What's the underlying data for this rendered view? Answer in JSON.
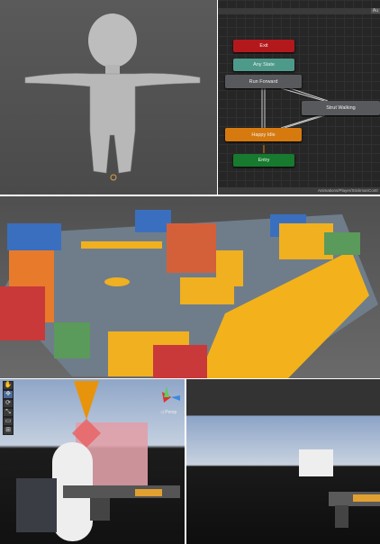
{
  "animator": {
    "header_button": "Au",
    "states": {
      "exit": "Exit",
      "any_state": "Any State",
      "run_forward": "Run Forward",
      "strut_walking": "Strut Walking",
      "happy_idle": "Happy Idle",
      "entry": "Entry"
    },
    "path": "Animations/Player/StickmanContr",
    "colors": {
      "exit": "#b3191c",
      "any_state": "#4e9a8a",
      "default": "#58595c",
      "happy_idle": "#d67a0f",
      "entry": "#177a2f"
    }
  },
  "scene_view": {
    "tools": [
      "✋",
      "✥",
      "⟳",
      "⤡",
      "▭",
      "⊞"
    ],
    "projection_label": "◁ Persp"
  }
}
